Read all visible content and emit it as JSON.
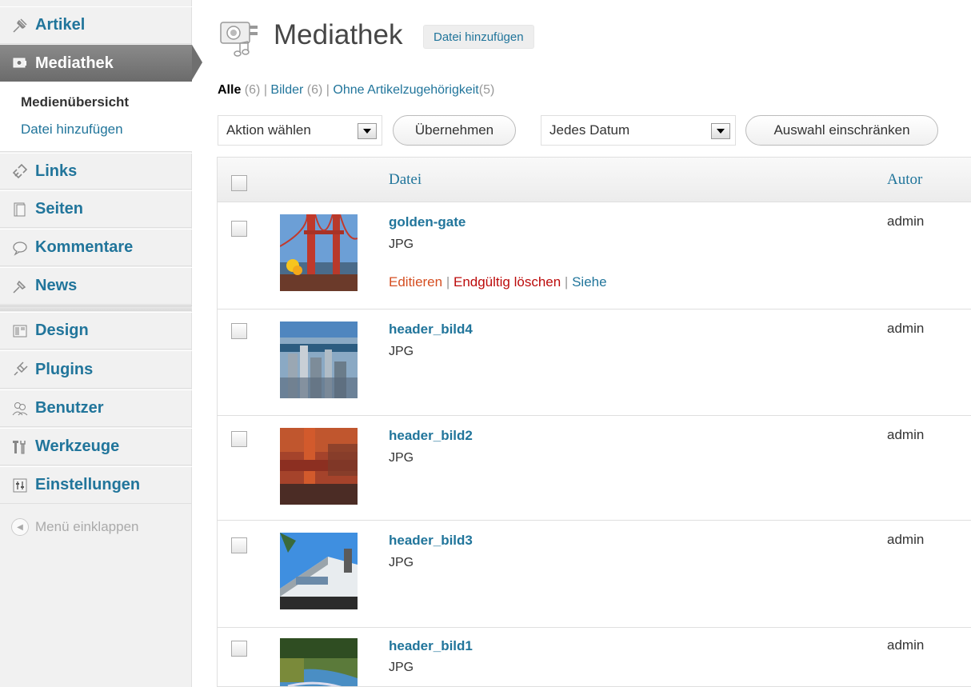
{
  "sidebar": {
    "items": [
      {
        "label": "Artikel",
        "icon": "pushpin-icon"
      },
      {
        "label": "Mediathek",
        "icon": "media-icon"
      },
      {
        "label": "Links",
        "icon": "link-icon"
      },
      {
        "label": "Seiten",
        "icon": "pages-icon"
      },
      {
        "label": "Kommentare",
        "icon": "comment-icon"
      },
      {
        "label": "News",
        "icon": "pushpin-icon"
      },
      {
        "label": "Design",
        "icon": "appearance-icon"
      },
      {
        "label": "Plugins",
        "icon": "plugin-icon"
      },
      {
        "label": "Benutzer",
        "icon": "users-icon"
      },
      {
        "label": "Werkzeuge",
        "icon": "tools-icon"
      },
      {
        "label": "Einstellungen",
        "icon": "settings-icon"
      }
    ],
    "submenu": {
      "current": "Medienübersicht",
      "add": "Datei hinzufügen"
    },
    "collapse_label": "Menü einklappen"
  },
  "header": {
    "title": "Mediathek",
    "add_button": "Datei hinzufügen"
  },
  "filters": [
    {
      "label": "Alle",
      "count": "(6)",
      "current": true
    },
    {
      "label": "Bilder",
      "count": "(6)",
      "current": false
    },
    {
      "label": "Ohne Artikelzugehörigkeit",
      "count": "(5)",
      "current": false
    }
  ],
  "toolbar": {
    "bulk_action": "Aktion wählen",
    "apply": "Übernehmen",
    "date_filter": "Jedes Datum",
    "filter_button": "Auswahl einschränken"
  },
  "table": {
    "col_file": "Datei",
    "col_author": "Autor",
    "rows": [
      {
        "name": "golden-gate",
        "type": "JPG",
        "author": "admin",
        "show_actions": true
      },
      {
        "name": "header_bild4",
        "type": "JPG",
        "author": "admin",
        "show_actions": false
      },
      {
        "name": "header_bild2",
        "type": "JPG",
        "author": "admin",
        "show_actions": false
      },
      {
        "name": "header_bild3",
        "type": "JPG",
        "author": "admin",
        "show_actions": false
      },
      {
        "name": "header_bild1",
        "type": "JPG",
        "author": "admin",
        "show_actions": false
      }
    ],
    "row_actions": {
      "edit": "Editieren",
      "delete": "Endgültig löschen",
      "view": "Siehe"
    }
  },
  "colors": {
    "link": "#21759b",
    "active_menu": "#6f6f6f",
    "delete": "#bc0b0b",
    "edit": "#d54e21"
  }
}
